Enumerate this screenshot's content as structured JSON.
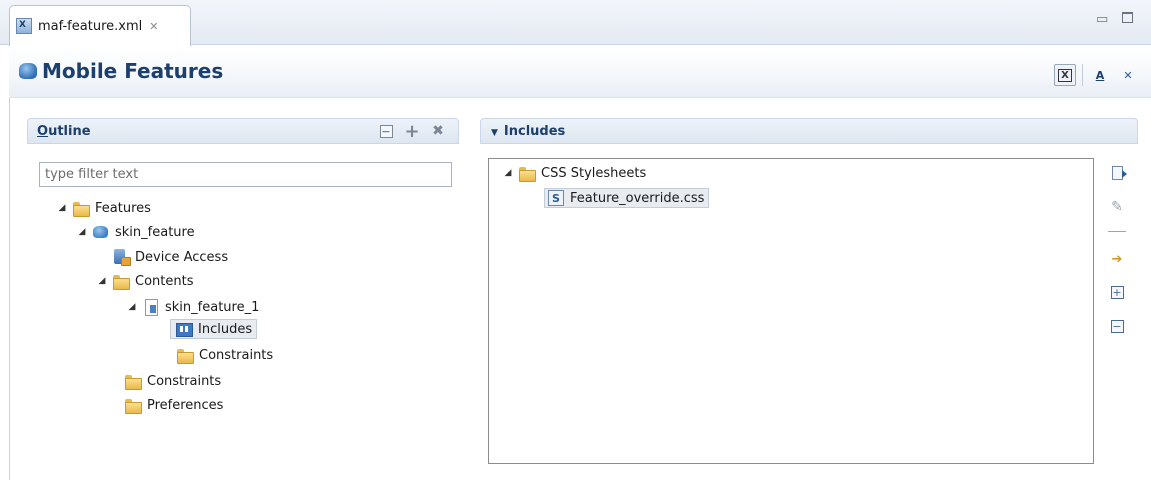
{
  "editor_tab": {
    "label": "maf-feature.xml",
    "close_glyph": "✕"
  },
  "window_controls": {
    "minimize": "▭",
    "maximize": "🗖"
  },
  "header": {
    "title": "Mobile Features",
    "tools": {
      "source_label": "X",
      "design_label": "A",
      "other_label": "✕"
    }
  },
  "outline": {
    "title_u": "O",
    "title_rest": "utline",
    "filter_placeholder": "type filter text",
    "tools": {
      "collapse": "⊟",
      "add": "+",
      "remove": "✖"
    },
    "tree": [
      {
        "label": "Features"
      },
      {
        "label": "skin_feature"
      },
      {
        "label": "Device Access"
      },
      {
        "label": "Contents"
      },
      {
        "label": "skin_feature_1"
      },
      {
        "label": "Includes"
      },
      {
        "label": "Constraints"
      },
      {
        "label": "Constraints"
      },
      {
        "label": "Preferences"
      }
    ]
  },
  "includes": {
    "title": "Includes",
    "tree": [
      {
        "label": "CSS Stylesheets"
      },
      {
        "label": "Feature_override.css",
        "icon_letter": "S"
      }
    ]
  },
  "colors": {
    "title": "#1d3f6b",
    "accent": "#3f7ac1",
    "folder": "#eab84a"
  }
}
